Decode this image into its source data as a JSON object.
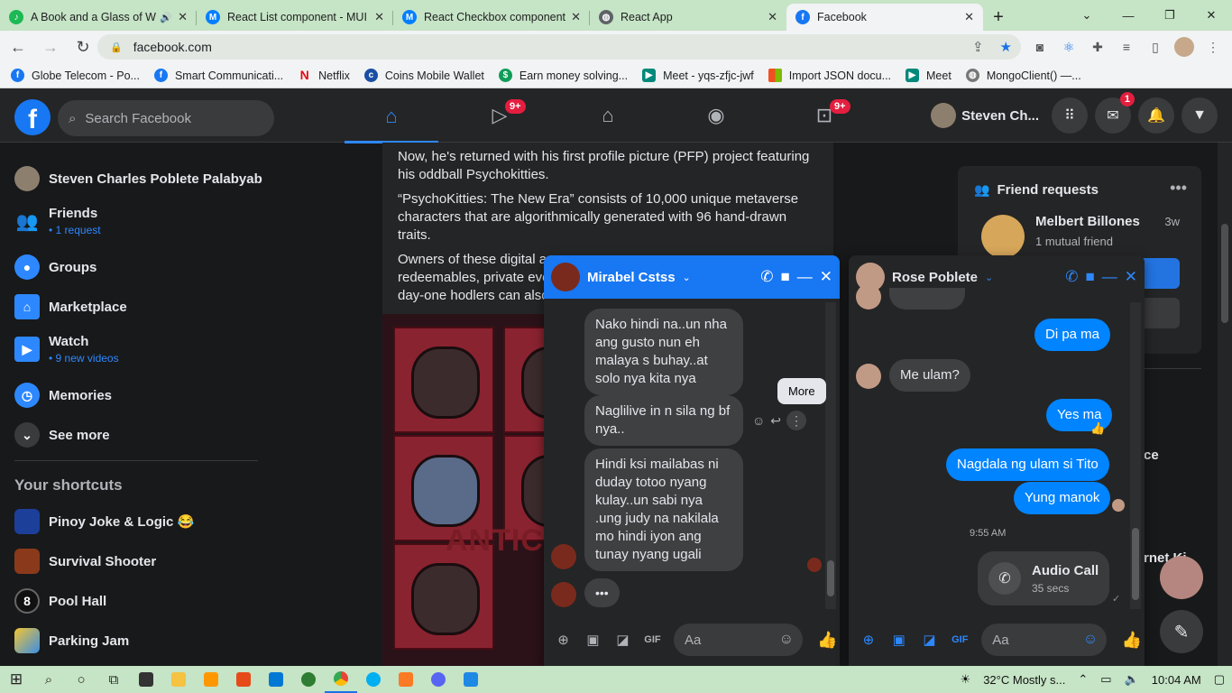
{
  "browser": {
    "tabs": [
      {
        "title": "A Book and a Glass of W",
        "icon": "spotify-icon",
        "color": "#1db954",
        "active": false,
        "audio": true
      },
      {
        "title": "React List component - MUI",
        "icon": "mui-icon",
        "color": "#007fff",
        "active": false
      },
      {
        "title": "React Checkbox component",
        "icon": "mui-icon",
        "color": "#007fff",
        "active": false
      },
      {
        "title": "React App",
        "icon": "globe-icon",
        "color": "#5f6368",
        "active": false
      },
      {
        "title": "Facebook",
        "icon": "facebook-icon",
        "color": "#1877f2",
        "active": true
      }
    ],
    "url": "facebook.com",
    "bookmarks": [
      {
        "label": "Globe Telecom - Po...",
        "icon": "facebook-icon",
        "color": "#1877f2"
      },
      {
        "label": "Smart Communicati...",
        "icon": "facebook-icon",
        "color": "#1877f2"
      },
      {
        "label": "Netflix",
        "icon": "netflix-icon",
        "color": "#e50914"
      },
      {
        "label": "Coins Mobile Wallet",
        "icon": "coins-icon",
        "color": "#1a4fa3"
      },
      {
        "label": "Earn money solving...",
        "icon": "earn-icon",
        "color": "#0f9d58"
      },
      {
        "label": "Meet - yqs-zfjc-jwf",
        "icon": "meet-icon",
        "color": "#00897b"
      },
      {
        "label": "Import JSON docu...",
        "icon": "microsoft-icon",
        "color": "#f25022"
      },
      {
        "label": "Meet",
        "icon": "meet-icon",
        "color": "#00897b"
      },
      {
        "label": "MongoClient() —...",
        "icon": "globe-icon",
        "color": "#777777"
      }
    ]
  },
  "facebook": {
    "search_placeholder": "Search Facebook",
    "nav_badges": {
      "watch": "9+",
      "gaming": "9+"
    },
    "profile_name": "Steven Ch...",
    "messenger_badge": "1",
    "sidebar": {
      "profile": "Steven Charles Poblete Palabyab",
      "friends": {
        "label": "Friends",
        "sub": "1 request"
      },
      "groups": "Groups",
      "marketplace": "Marketplace",
      "watch": {
        "label": "Watch",
        "sub": "9 new videos"
      },
      "memories": "Memories",
      "see_more": "See more",
      "shortcuts_title": "Your shortcuts",
      "shortcuts": [
        "Pinoy Joke & Logic 😂",
        "Survival Shooter",
        "Pool Hall",
        "Parking Jam"
      ]
    },
    "feed": {
      "p1": "Now, he's returned with his first profile picture (PFP) project featuring his oddball Psychokitties.",
      "p2": "“PsychoKitties: The New Era” consists of 10,000 unique metaverse characters that are algorithmically generated with 96 hand-drawn traits.",
      "p3a": "Owners of these digital a",
      "p3b": "redeemables, private eve",
      "p3c": "day-one hodlers can also",
      "image_text": "ANTICI"
    },
    "friend_requests": {
      "title": "Friend requests",
      "name": "Melbert Billones",
      "time": "3w",
      "mutual": "1 mutual friend"
    },
    "partial_right_1": "ce",
    "partial_right_2": "rnet Ki"
  },
  "chat1": {
    "name": "Mirabel Cstss",
    "messages": [
      "Nako hindi na..un nha ang gusto nun eh malaya s buhay..at solo nya kita nya",
      "Naglilive in n sila ng bf nya..",
      "Hindi ksi mailabas ni duday totoo nyang kulay..un sabi nya .ung judy na nakilala mo hindi iyon ang tunay nyang ugali"
    ],
    "typing": "•••",
    "tooltip": "More",
    "input_placeholder": "Aa"
  },
  "chat2": {
    "name": "Rose Poblete",
    "messages": {
      "out1": "Di pa ma",
      "in1": "Me ulam?",
      "out2": "Yes ma",
      "reaction": "👍",
      "out3": "Nagdala ng ulam si Tito",
      "out4": "Yung manok"
    },
    "timestamp": "9:55 AM",
    "call": {
      "title": "Audio Call",
      "duration": "35 secs"
    },
    "input_placeholder": "Aa"
  },
  "taskbar": {
    "weather": "32°C  Mostly s...",
    "time": "10:04 AM"
  }
}
